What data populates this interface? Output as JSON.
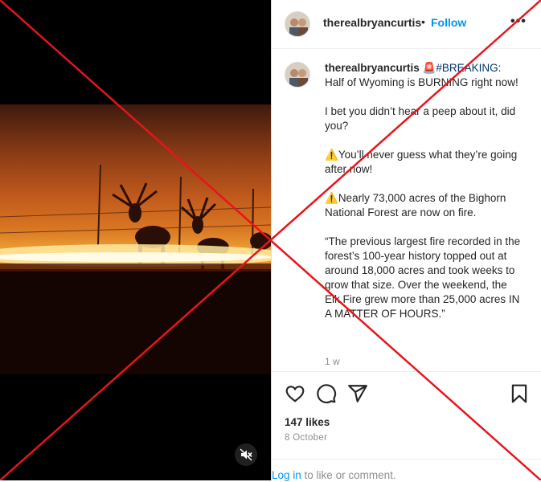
{
  "post": {
    "username": "therealbryancurtis",
    "dot": "•",
    "follow_label": "Follow",
    "more_label": "•••"
  },
  "caption": {
    "username": "therealbryancurtis",
    "siren_emoji": "🚨",
    "hashtag": "#BREAKING",
    "line1_rest": ": Half of Wyoming is BURNING right now!",
    "para2": "I bet you didn’t hear a peep about it, did you?",
    "warning_emoji": "⚠️",
    "para3": "You’ll never guess what they’re going after now!",
    "para4": "Nearly 73,000 acres of the Bighorn National Forest are now on fire.",
    "para5": "“The previous largest fire recorded in the forest’s 100-year history topped out at around 18,000 acres and took weeks to grow that size. Over the weekend, the Elk Fire grew more than 25,000 acres IN A MATTER OF HOURS.”",
    "time_ago": "1 w"
  },
  "engagement": {
    "likes": "147 likes",
    "date": "8 October"
  },
  "login": {
    "link": "Log in",
    "rest": " to like or comment."
  },
  "icons": {
    "like": "heart-icon",
    "comment": "comment-icon",
    "share": "send-icon",
    "save": "bookmark-icon",
    "mute": "muted-speaker-icon",
    "more": "more-options-icon"
  },
  "colors": {
    "accent": "#0095f6",
    "x_overlay": "#e8141b",
    "hashtag": "#00376b"
  }
}
